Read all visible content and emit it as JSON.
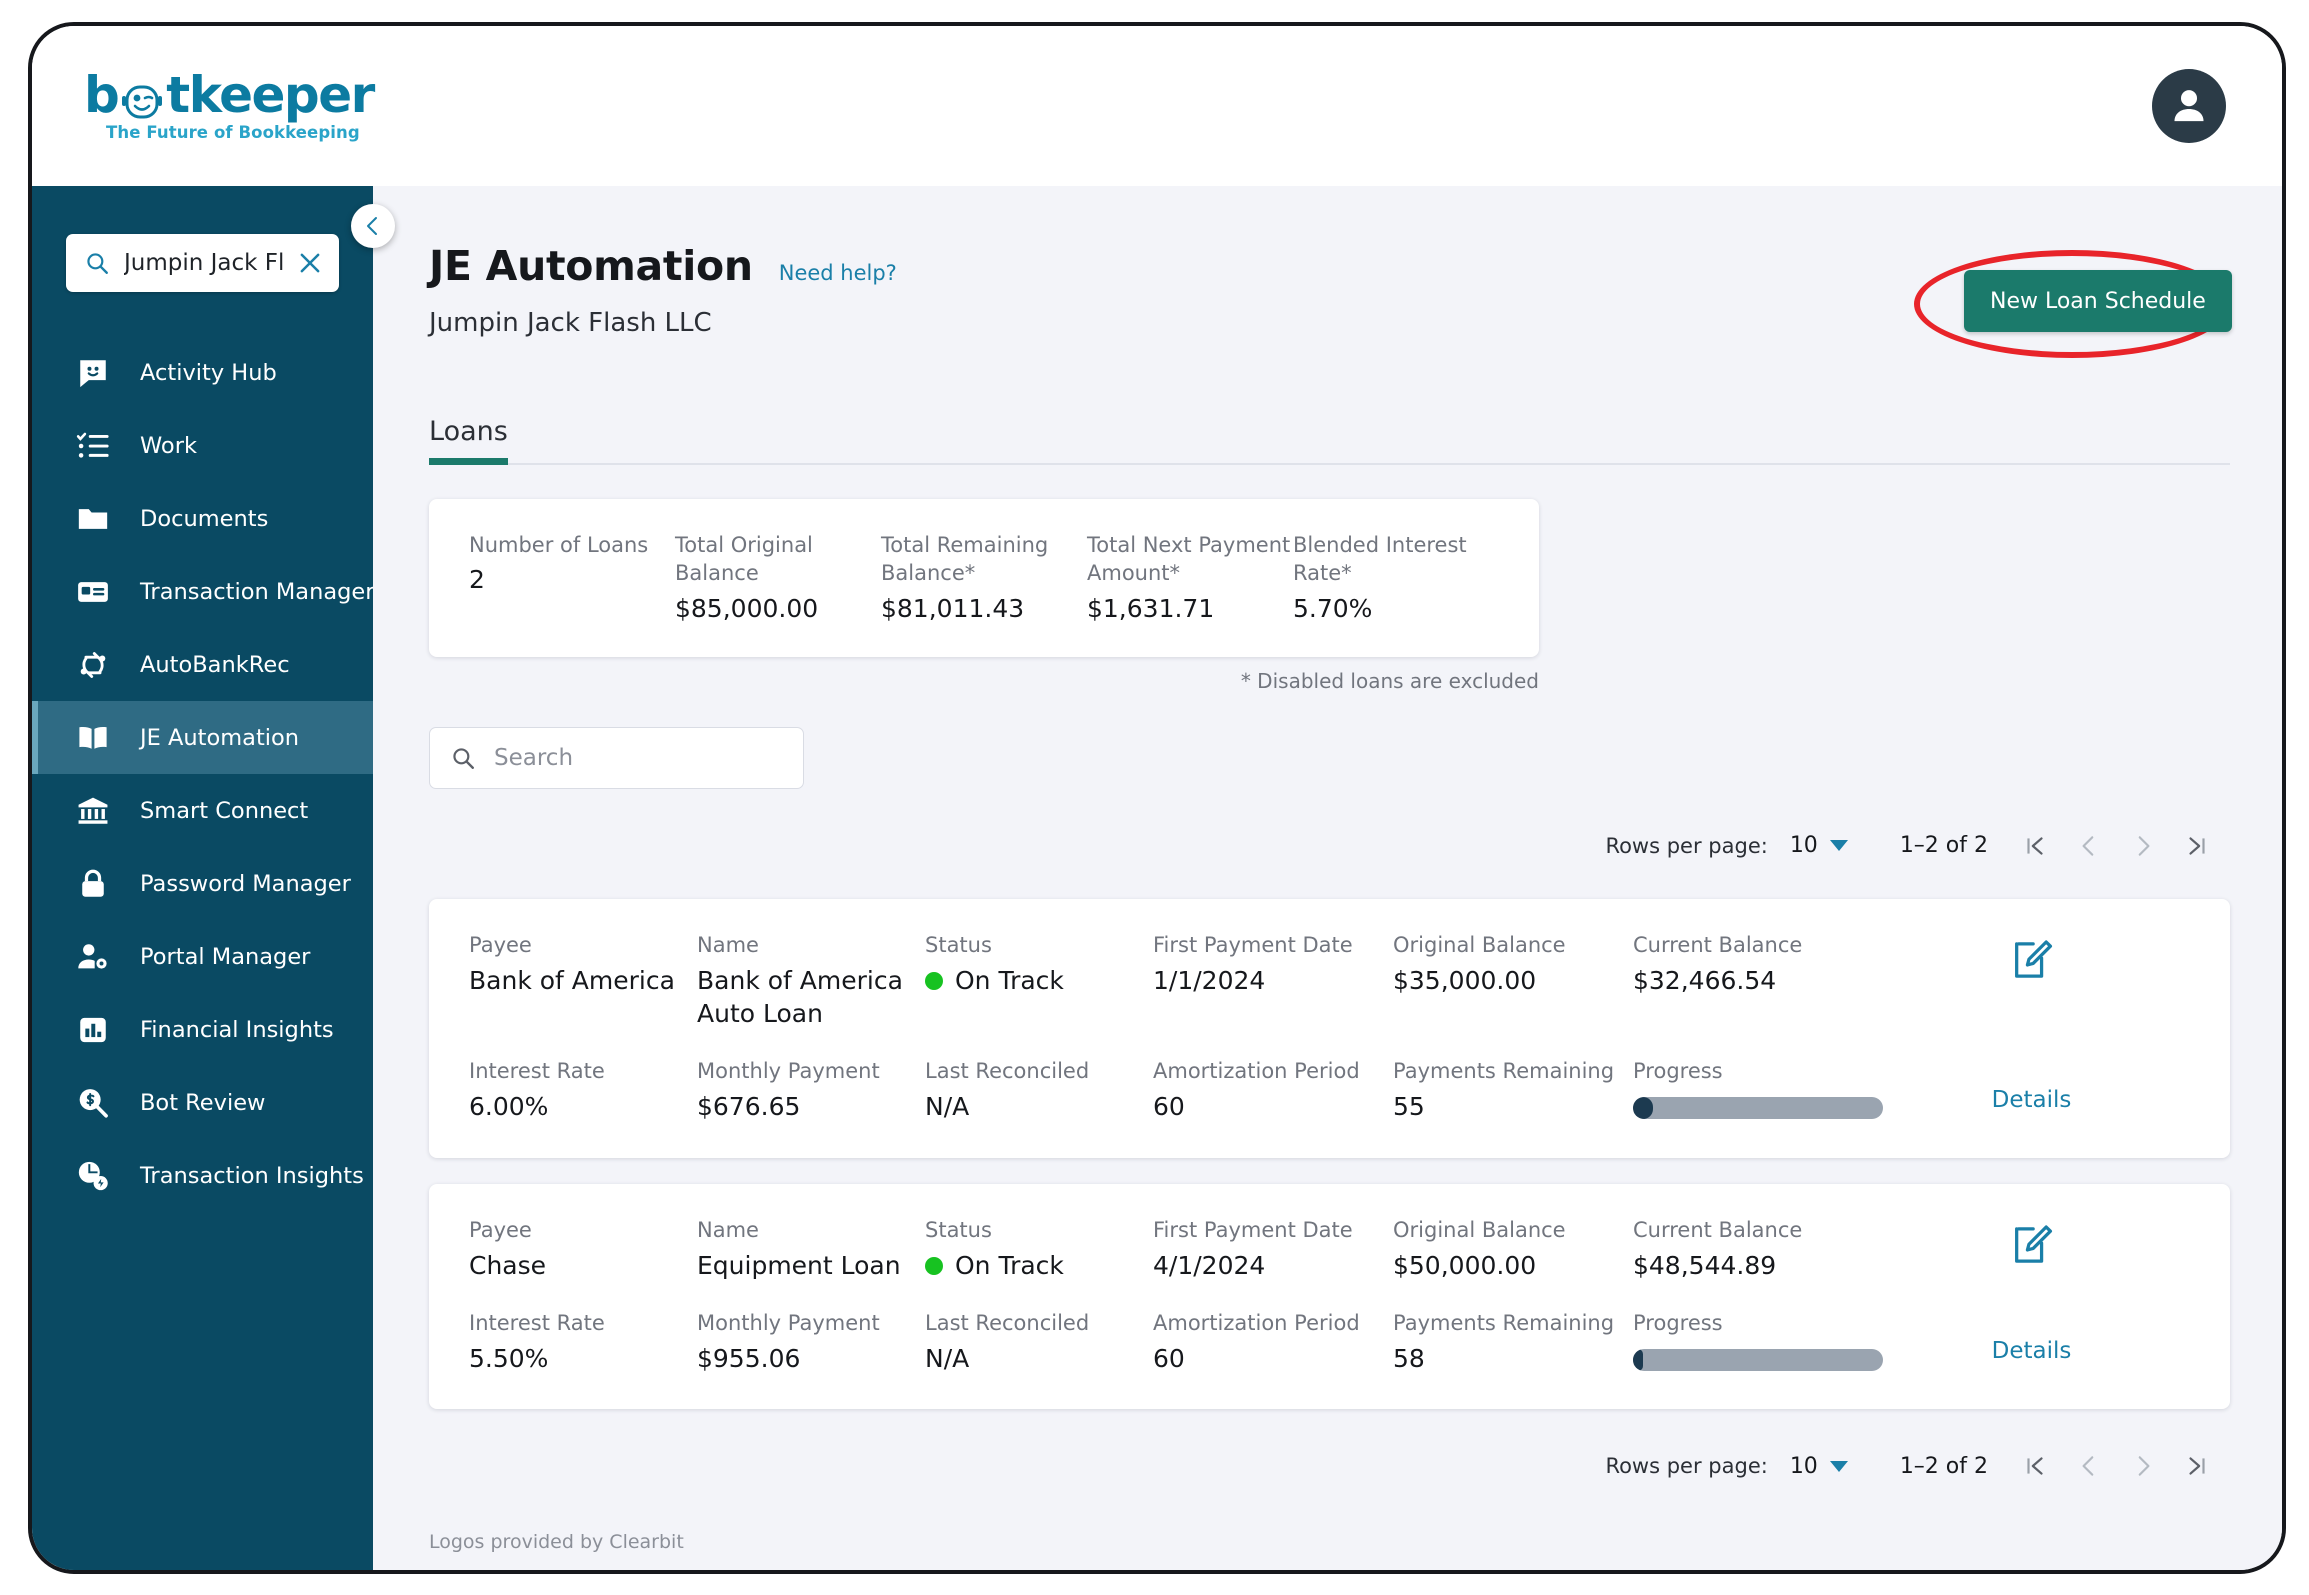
{
  "brand": {
    "logo_main_1": "b",
    "logo_main_2": "tkeeper",
    "tagline": "The Future of Bookkeeping",
    "accent_teal": "#1b7a6b",
    "sidebar_bg": "#0a4a63",
    "link_blue": "#1a7fa8",
    "annotation_red": "#e8242a"
  },
  "sidebar": {
    "search": {
      "value": "Jumpin Jack Flash ...",
      "icon": "search-icon",
      "clear_icon": "close-icon"
    },
    "items": [
      {
        "label": "Activity Hub",
        "icon": "chat-smiley-icon",
        "active": false
      },
      {
        "label": "Work",
        "icon": "checklist-icon",
        "active": false
      },
      {
        "label": "Documents",
        "icon": "folder-icon",
        "active": false
      },
      {
        "label": "Transaction Manager",
        "icon": "card-icon",
        "active": false
      },
      {
        "label": "AutoBankRec",
        "icon": "sync-icon",
        "active": false
      },
      {
        "label": "JE Automation",
        "icon": "book-icon",
        "active": true
      },
      {
        "label": "Smart Connect",
        "icon": "bank-icon",
        "active": false
      },
      {
        "label": "Password Manager",
        "icon": "lock-icon",
        "active": false
      },
      {
        "label": "Portal Manager",
        "icon": "user-gear-icon",
        "active": false
      },
      {
        "label": "Financial Insights",
        "icon": "bar-chart-icon",
        "active": false
      },
      {
        "label": "Bot Review",
        "icon": "money-search-icon",
        "active": false
      },
      {
        "label": "Transaction Insights",
        "icon": "pie-bolt-icon",
        "active": false
      }
    ],
    "collapse_icon": "chevron-left-icon"
  },
  "header": {
    "title": "JE Automation",
    "help_link": "Need help?",
    "company": "Jumpin Jack Flash LLC",
    "new_loan_button": "New Loan Schedule"
  },
  "tabs": [
    {
      "label": "Loans",
      "active": true
    }
  ],
  "summary": {
    "cells": [
      {
        "label": "Number of Loans",
        "value": "2"
      },
      {
        "label": "Total Original Balance",
        "value": "$85,000.00"
      },
      {
        "label": "Total Remaining Balance*",
        "value": "$81,011.43"
      },
      {
        "label": "Total Next Payment Amount*",
        "value": "$1,631.71"
      },
      {
        "label": "Blended Interest Rate*",
        "value": "5.70%"
      }
    ],
    "disclaimer": "* Disabled loans are excluded"
  },
  "search": {
    "placeholder": "Search",
    "value": ""
  },
  "pagination": {
    "rows_label": "Rows per page:",
    "rows_value": "10",
    "range": "1–2 of 2",
    "first_icon": "first-page-icon",
    "prev_icon": "chevron-left-icon",
    "next_icon": "chevron-right-icon",
    "last_icon": "last-page-icon"
  },
  "labels": {
    "payee": "Payee",
    "name": "Name",
    "status": "Status",
    "first_payment_date": "First Payment Date",
    "original_balance": "Original Balance",
    "current_balance": "Current Balance",
    "interest_rate": "Interest Rate",
    "monthly_payment": "Monthly Payment",
    "last_reconciled": "Last Reconciled",
    "amortization_period": "Amortization Period",
    "payments_remaining": "Payments Remaining",
    "progress": "Progress",
    "details": "Details",
    "edit_icon": "edit-pencil-icon"
  },
  "loans": [
    {
      "payee": "Bank of America",
      "name": "Bank of America Auto Loan",
      "status": "On Track",
      "status_color": "#17c221",
      "first_payment_date": "1/1/2024",
      "original_balance": "$35,000.00",
      "current_balance": "$32,466.54",
      "interest_rate": "6.00%",
      "monthly_payment": "$676.65",
      "last_reconciled": "N/A",
      "amortization_period": "60",
      "payments_remaining": "55",
      "progress_percent": 8
    },
    {
      "payee": "Chase",
      "name": "Equipment Loan",
      "status": "On Track",
      "status_color": "#17c221",
      "first_payment_date": "4/1/2024",
      "original_balance": "$50,000.00",
      "current_balance": "$48,544.89",
      "interest_rate": "5.50%",
      "monthly_payment": "$955.06",
      "last_reconciled": "N/A",
      "amortization_period": "60",
      "payments_remaining": "58",
      "progress_percent": 4
    }
  ],
  "footer": {
    "text": "Logos provided by Clearbit"
  }
}
